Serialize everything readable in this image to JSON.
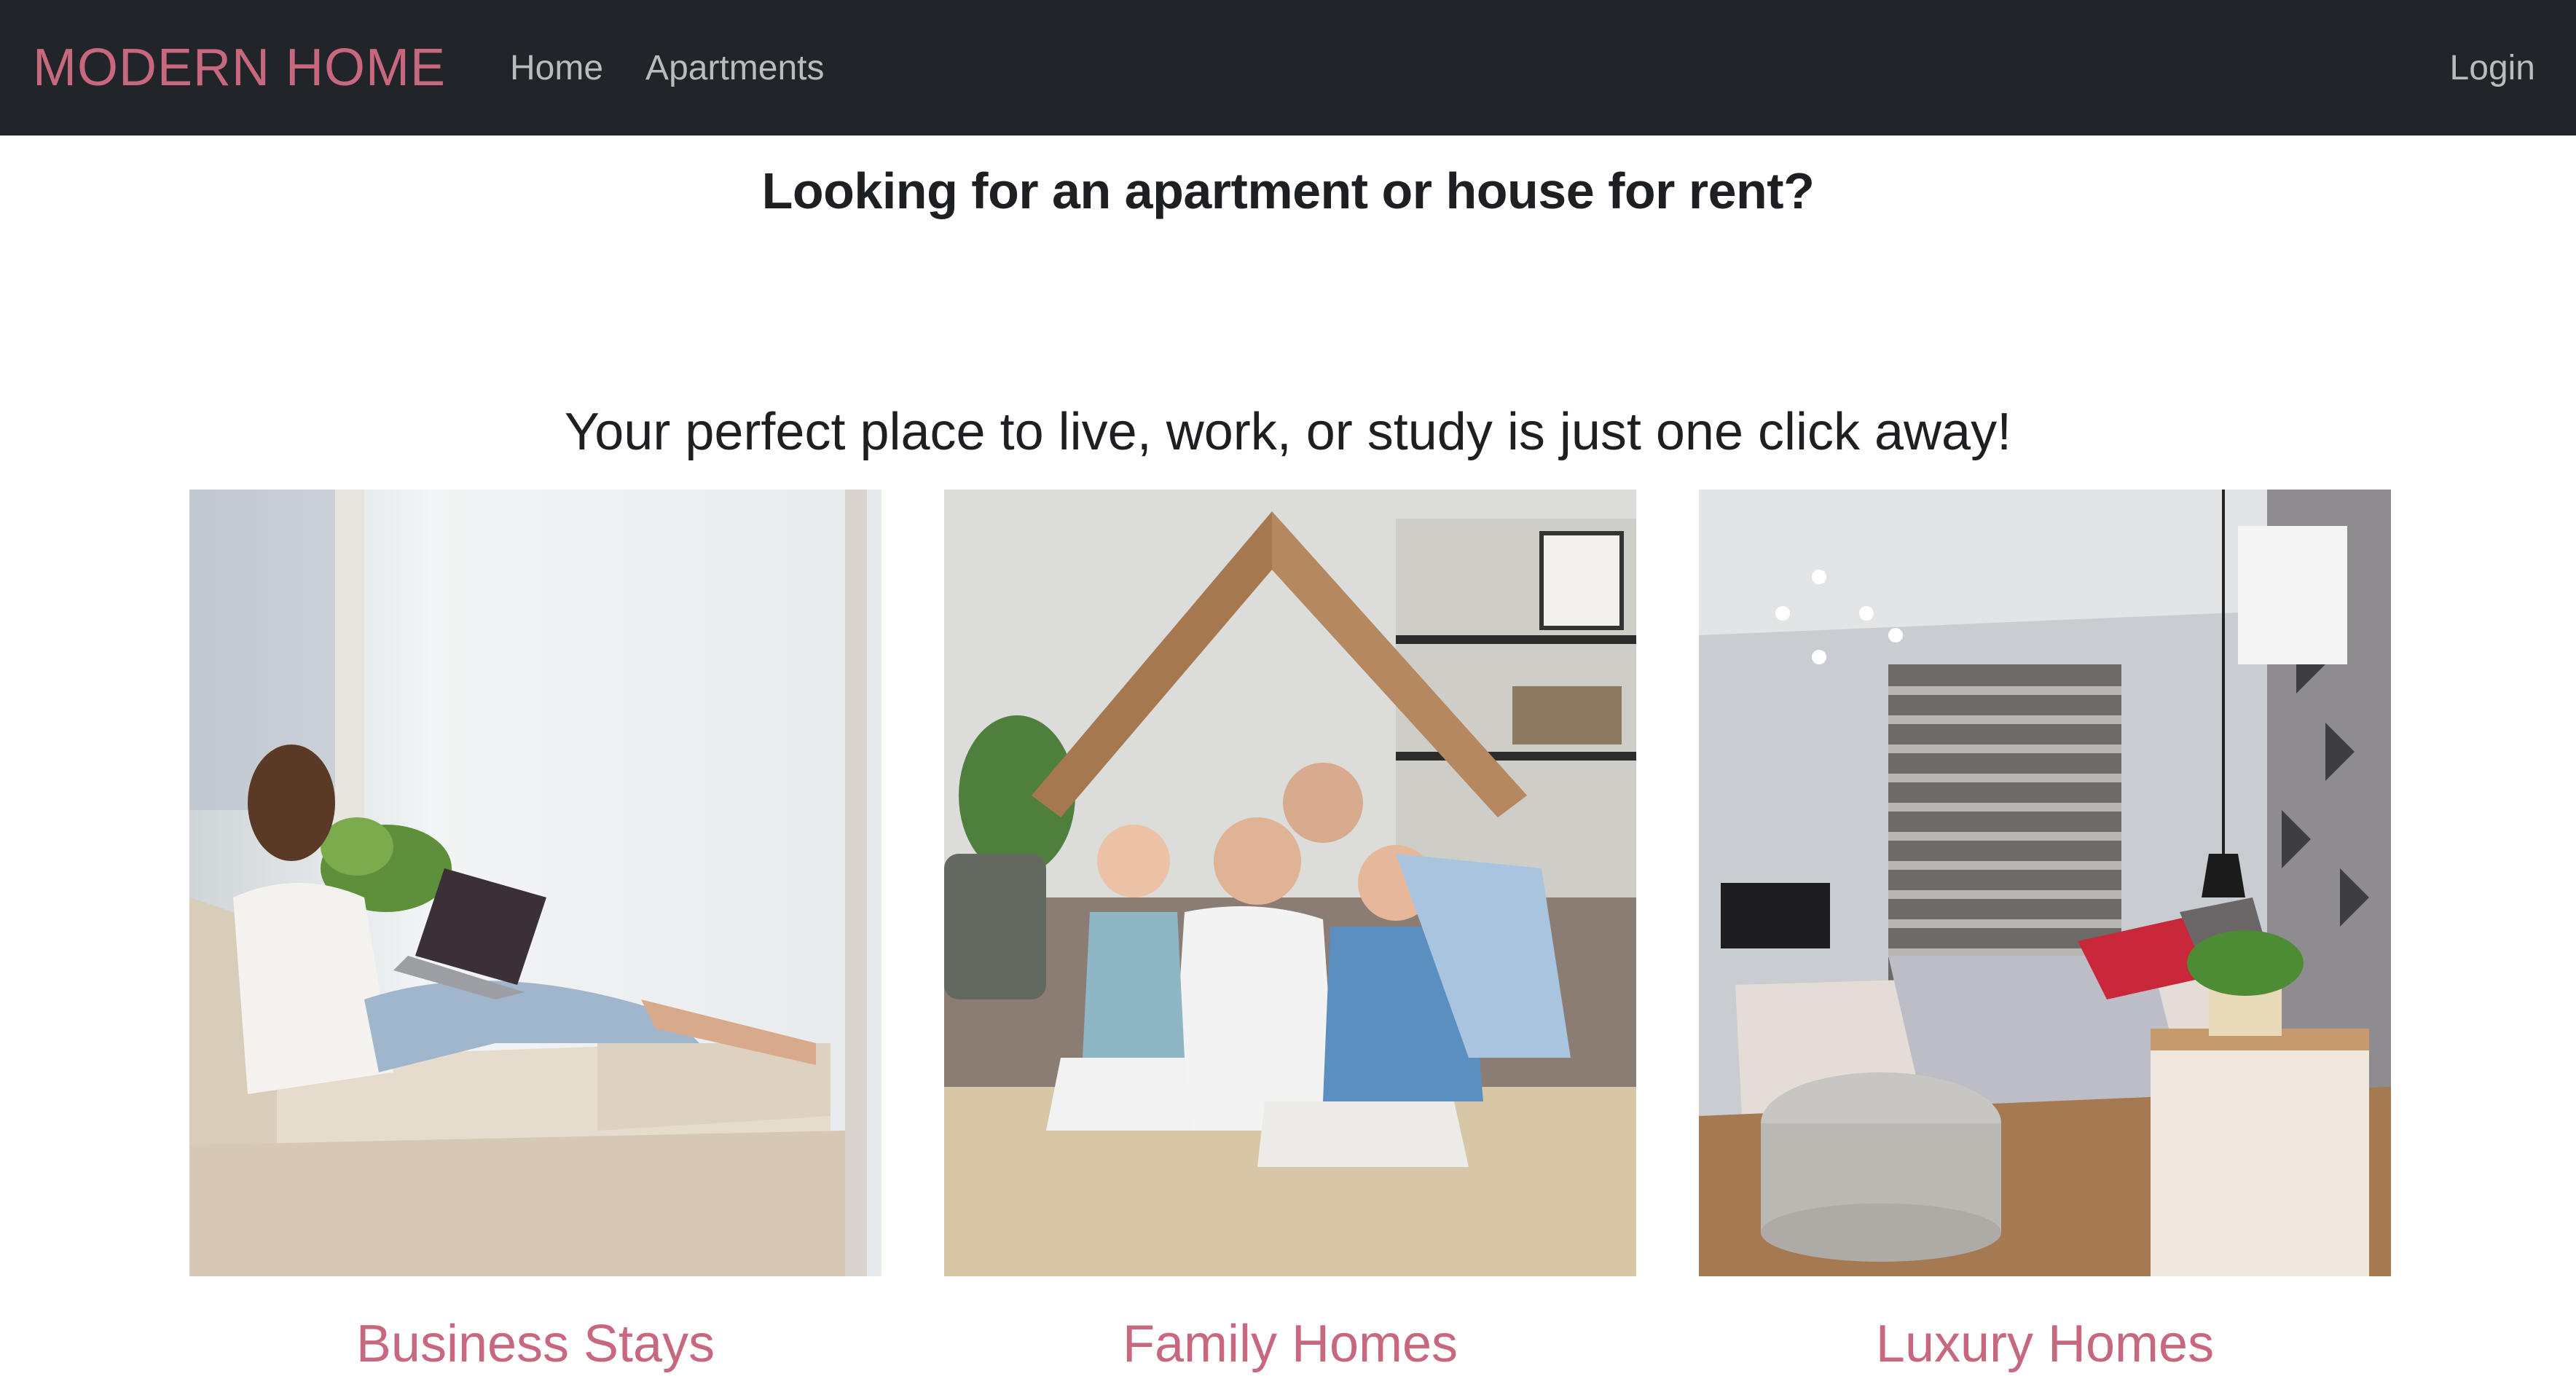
{
  "navbar": {
    "brand": "MODERN HOME",
    "links": [
      {
        "label": "Home"
      },
      {
        "label": "Apartments"
      }
    ],
    "login_label": "Login"
  },
  "hero": {
    "headline": "Looking for an apartment or house for rent?",
    "subline": "Your perfect place to live, work, or study is just one click away!"
  },
  "cards": [
    {
      "title": "Business Stays",
      "image": "woman-with-laptop-on-sofa-photo"
    },
    {
      "title": "Family Homes",
      "image": "family-under-cardboard-roof-photo"
    },
    {
      "title": "Luxury Homes",
      "image": "modern-bedroom-interior-photo"
    }
  ],
  "colors": {
    "navbar_bg": "#212529",
    "accent": "#c8687f",
    "nav_text": "#b9bcbf",
    "heading_text": "#1d1f22"
  }
}
